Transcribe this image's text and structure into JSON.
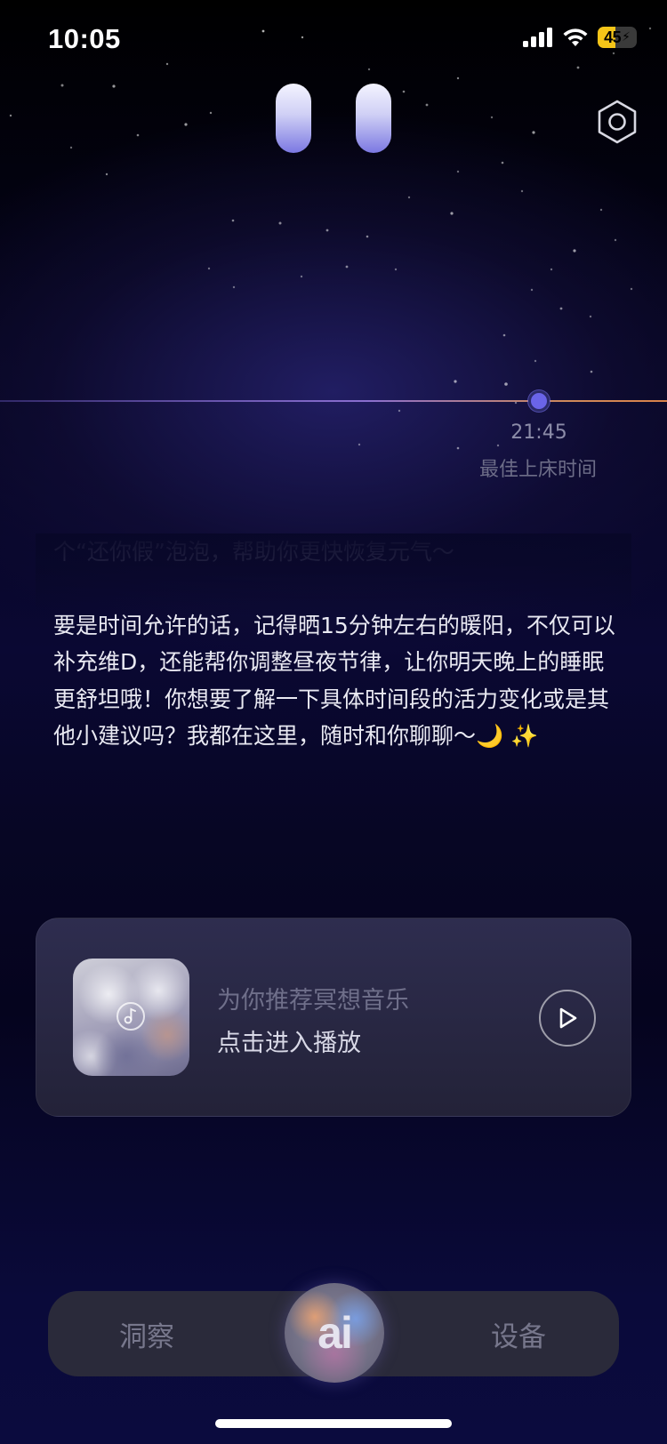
{
  "status_bar": {
    "time": "10:05",
    "battery_level": "45",
    "battery_percent": 45,
    "battery_color": "#f5c518",
    "icons": [
      "cellular-signal-icon",
      "wifi-icon",
      "battery-charging-icon"
    ]
  },
  "header": {
    "settings_icon": "hexagon-settings-icon"
  },
  "timeline": {
    "time": "21:45",
    "label": "最佳上床时间",
    "marker_color": "#6a64e8"
  },
  "chat": {
    "faded_line": "个“还你假”泡泡，帮助你更快恢复元气～",
    "message": "要是时间允许的话，记得晒15分钟左右的暖阳，不仅可以补充维D，还能帮你调整昼夜节律，让你明天晚上的睡眠更舒坦哦！你想要了解一下具体时间段的活力变化或是其他小建议吗？我都在这里，随时和你聊聊～🌙 ✨"
  },
  "music_card": {
    "title": "为你推荐冥想音乐",
    "subtitle": "点击进入播放",
    "icons": [
      "music-note-icon",
      "play-icon"
    ]
  },
  "bottom_nav": {
    "left_tab": "洞察",
    "center": "ai",
    "right_tab": "设备"
  }
}
